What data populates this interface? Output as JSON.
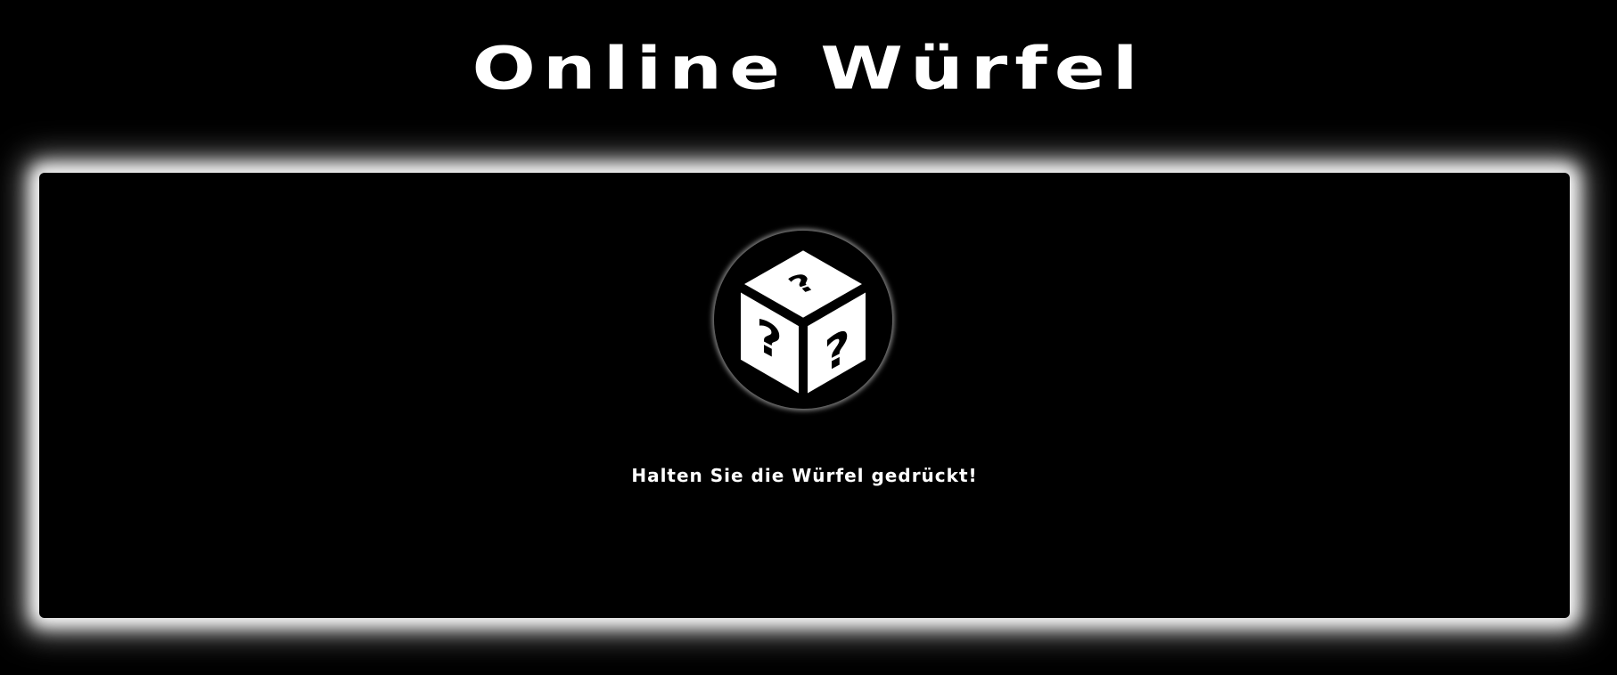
{
  "header": {
    "title": "Online Würfel"
  },
  "dice": {
    "icon": "question-dice-icon",
    "hint": "Halten Sie die Würfel gedrückt!"
  },
  "colors": {
    "background": "#000000",
    "foreground": "#ffffff"
  }
}
